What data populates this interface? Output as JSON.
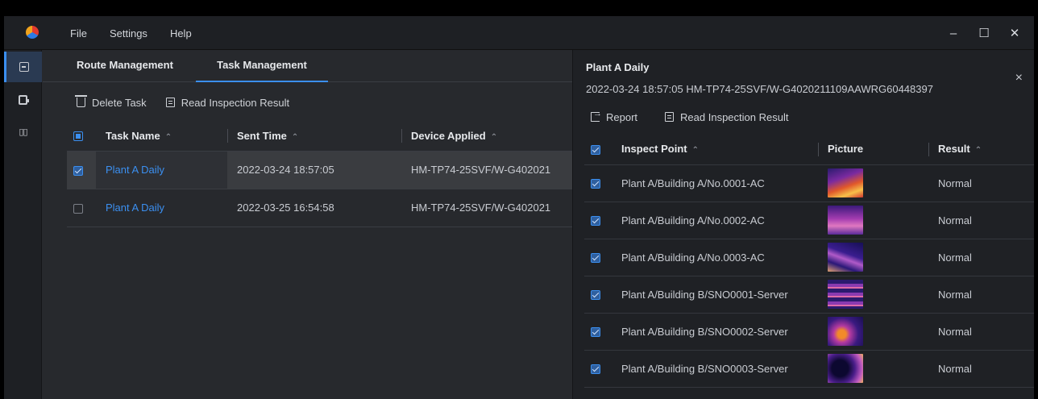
{
  "menu": {
    "file": "File",
    "settings": "Settings",
    "help": "Help"
  },
  "window_controls": {
    "minimize": "–",
    "maximize": "☐",
    "close": "✕"
  },
  "tabs": [
    {
      "label": "Route Management"
    },
    {
      "label": "Task Management"
    }
  ],
  "toolbar": {
    "delete_task": "Delete Task",
    "read_result": "Read Inspection Result"
  },
  "task_table": {
    "headers": {
      "task_name": "Task Name",
      "sent_time": "Sent Time",
      "device_applied": "Device Applied"
    },
    "rows": [
      {
        "task_name": "Plant A Daily",
        "sent_time": "2022-03-24 18:57:05",
        "device": "HM-TP74-25SVF/W-G402021",
        "checked": true
      },
      {
        "task_name": "Plant A Daily",
        "sent_time": "2022-03-25 16:54:58",
        "device": "HM-TP74-25SVF/W-G402021",
        "checked": false
      }
    ]
  },
  "detail": {
    "title": "Plant A Daily",
    "subtitle": "2022-03-24 18:57:05  HM-TP74-25SVF/W-G4020211109AAWRG60448397",
    "close": "×",
    "report": "Report",
    "read_result": "Read Inspection Result",
    "headers": {
      "inspect_point": "Inspect Point",
      "picture": "Picture",
      "result": "Result"
    },
    "rows": [
      {
        "point": "Plant A/Building A/No.0001-AC",
        "result": "Normal"
      },
      {
        "point": "Plant A/Building A/No.0002-AC",
        "result": "Normal"
      },
      {
        "point": "Plant A/Building A/No.0003-AC",
        "result": "Normal"
      },
      {
        "point": "Plant A/Building B/SNO0001-Server",
        "result": "Normal"
      },
      {
        "point": "Plant A/Building B/SNO0002-Server",
        "result": "Normal"
      },
      {
        "point": "Plant A/Building B/SNO0003-Server",
        "result": "Normal"
      }
    ]
  },
  "colors": {
    "accent": "#3b8ff0",
    "panel": "#27292d",
    "detail_bg": "#1f2125"
  },
  "sort_glyph": "⌃"
}
